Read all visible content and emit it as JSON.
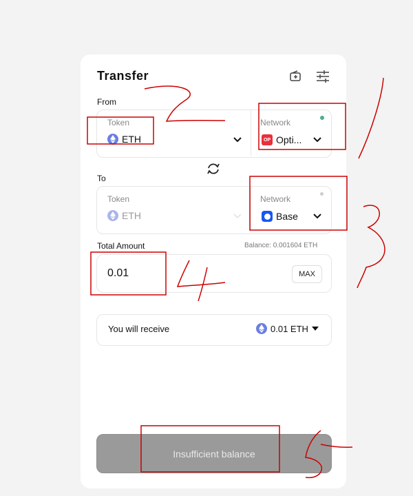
{
  "header": {
    "title": "Transfer",
    "icons": [
      "add-wallet-icon",
      "sliders-icon"
    ]
  },
  "from": {
    "label": "From",
    "token": {
      "label": "Token",
      "value": "ETH",
      "icon": "eth-icon"
    },
    "network": {
      "label": "Network",
      "value": "Opti...",
      "icon": "optimism-icon",
      "badge_text": "OP",
      "status_color": "#4caf87"
    }
  },
  "swap_icon": "swap-icon",
  "to": {
    "label": "To",
    "token": {
      "label": "Token",
      "value": "ETH",
      "icon": "eth-icon"
    },
    "network": {
      "label": "Network",
      "value": "Base",
      "icon": "base-icon",
      "status_color": "#cccccc"
    }
  },
  "amount": {
    "label": "Total Amount",
    "balance": "Balance: 0.001604 ETH",
    "value": "0.01",
    "max_label": "MAX"
  },
  "receive": {
    "label": "You will receive",
    "value": "0.01 ETH",
    "icon": "eth-icon"
  },
  "submit": {
    "label": "Insufficient balance"
  },
  "annotations": {
    "color": "#cc0000",
    "numbers": [
      "2",
      "1",
      "3",
      "4",
      "5"
    ]
  },
  "colors": {
    "accent_eth": "#6b7fe0",
    "optimism": "#e8303b",
    "base": "#1a56f0",
    "annotation": "#cc0000"
  }
}
